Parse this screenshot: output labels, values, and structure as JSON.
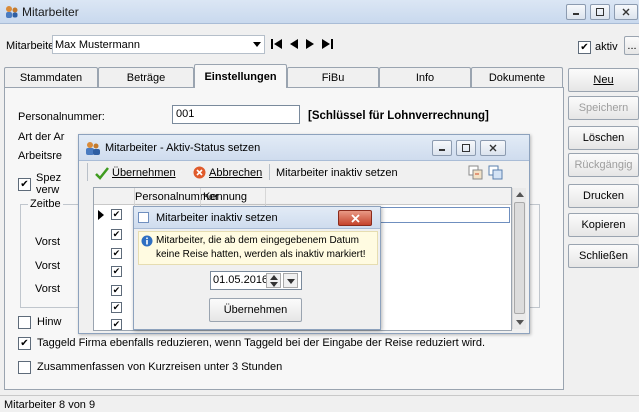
{
  "window": {
    "title": "Mitarbeiter"
  },
  "toolbar": {
    "employee_label": "Mitarbeiter:",
    "employee_value": "Max Mustermann",
    "aktiv_label": "aktiv",
    "more_button": "..."
  },
  "tabs": [
    "Stammdaten",
    "Beträge",
    "Einstellungen",
    "FiBu",
    "Info",
    "Dokumente"
  ],
  "form": {
    "personalnummer_label": "Personalnummer:",
    "personalnummer_value": "001",
    "schluessel_text": "[Schlüssel für Lohnverrechnung]",
    "art_label": "Art der Ar",
    "arbeitsre_label": "Arbeitsre",
    "spez_label_1": "Spez",
    "spez_label_2": "verw",
    "zeitbe_label": "Zeitbe",
    "vorst_1": "Vorst",
    "vorst_2": "Vorst",
    "vorst_3": "Vorst",
    "hinw_label": "Hinw",
    "taggeld_label": "Taggeld Firma ebenfalls reduzieren, wenn Taggeld bei der Eingabe der Reise reduziert wird.",
    "zusammenfassen_label": "Zusammenfassen von Kurzreisen unter 3 Stunden"
  },
  "side_buttons": [
    "Neu",
    "Speichern",
    "Löschen",
    "Rückgängig",
    "Drucken",
    "Kopieren",
    "Schließen"
  ],
  "status": {
    "text": "Mitarbeiter 8 von 9"
  },
  "aktiv_dialog": {
    "title": "Mitarbeiter - Aktiv-Status setzen",
    "toolbar_uebernehmen": "Übernehmen",
    "toolbar_abbrechen": "Abbrechen",
    "toolbar_inaktiv": "Mitarbeiter inaktiv setzen",
    "col_personalnummer": "Personalnummer",
    "col_kennung": "Kennung"
  },
  "inaktiv_dialog": {
    "title": "Mitarbeiter inaktiv setzen",
    "info_line1": "Mitarbeiter, die ab dem eingegebenem Datum",
    "info_line2": "keine Reise hatten, werden als inaktiv markiert!",
    "date_value": "01.05.2016",
    "button": "Übernehmen"
  }
}
